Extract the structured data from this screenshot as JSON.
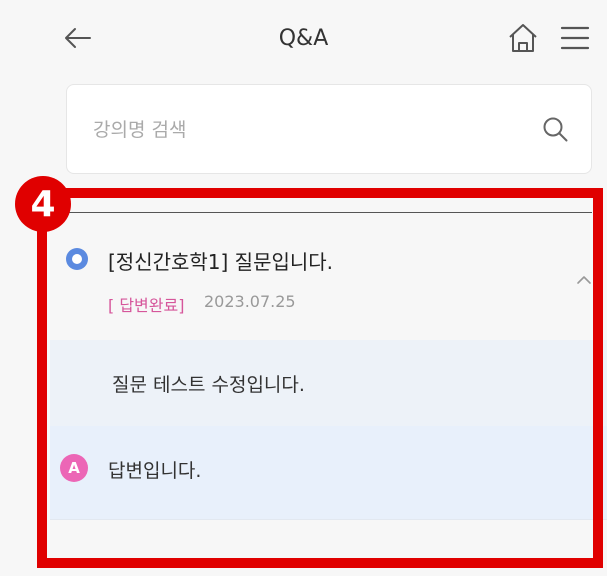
{
  "appbar": {
    "title": "Q&A",
    "icons": [
      "arrow-left-icon",
      "home-icon",
      "hamburger-menu-icon"
    ]
  },
  "search": {
    "placeholder": "강의명 검색",
    "value": "",
    "icon": "search-icon"
  },
  "questions": [
    {
      "title": "[정신간호학1] 질문입니다.",
      "status": "[ 답변완료]",
      "date": "2023.07.25",
      "expanded": true,
      "body": "질문 테스트 수정입니다.",
      "answer": {
        "badge": "A",
        "text": "답변입니다."
      }
    }
  ],
  "annotation": {
    "step_number": "4",
    "color": "#e00000"
  },
  "colors": {
    "q_badge": "#5b8ae0",
    "a_badge": "#ec66b6",
    "status": "#d6569b",
    "question_body_bg": "#edf2f8",
    "answer_bg": "#e8f0fb"
  }
}
